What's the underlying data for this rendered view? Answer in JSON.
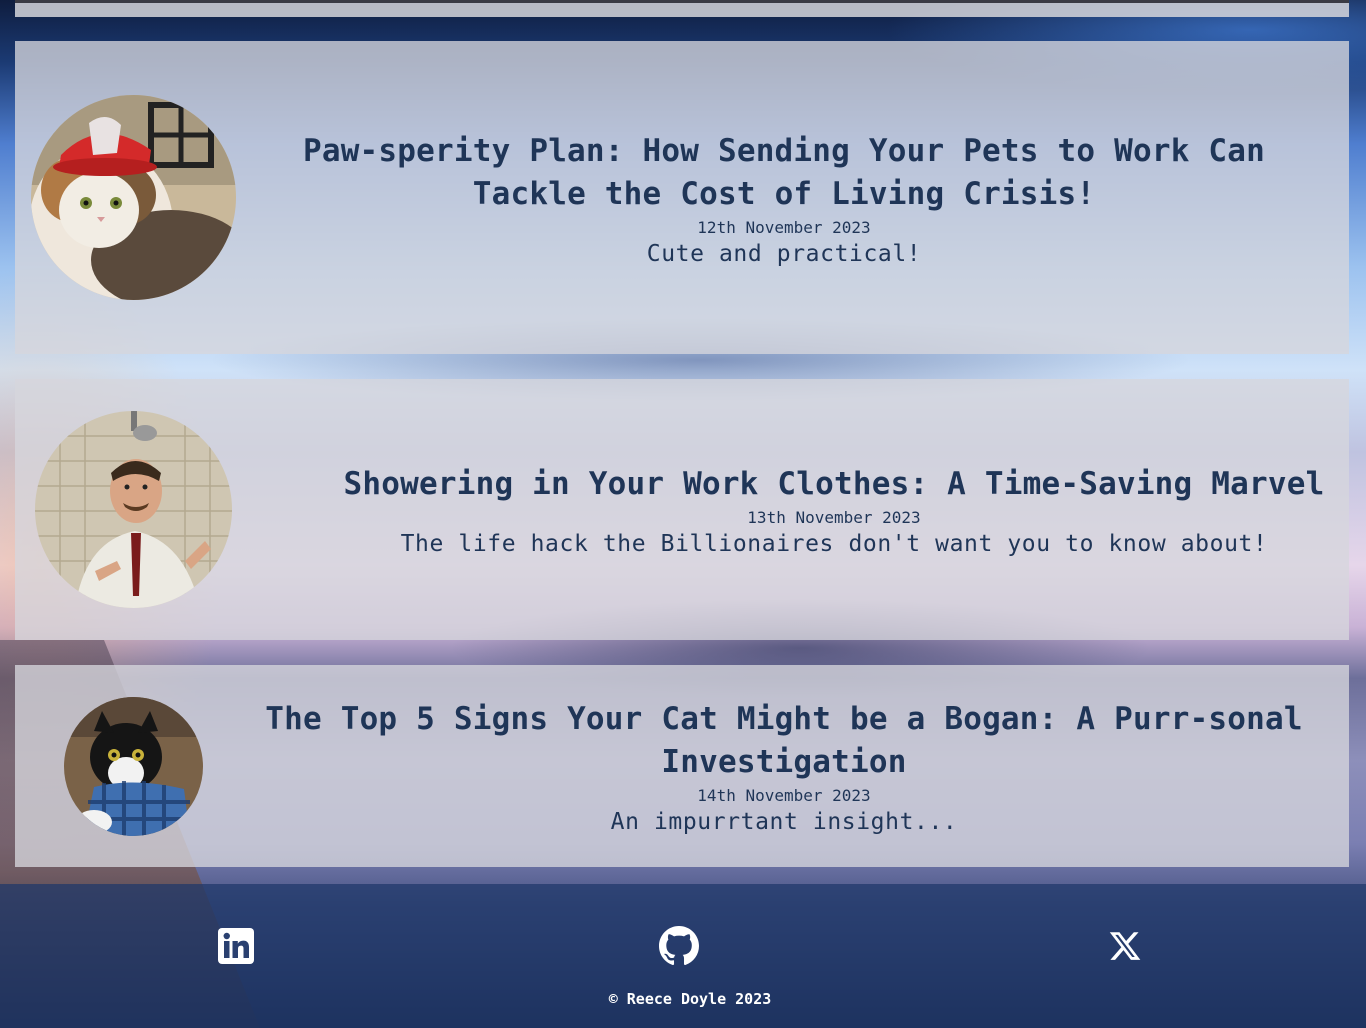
{
  "posts": [
    {
      "title": "Paw-sperity Plan: How Sending Your Pets to Work Can Tackle the Cost of Living Crisis!",
      "date": "12th November 2023",
      "description": "Cute and practical!",
      "image_subject": "cat wearing red firefighter helmet"
    },
    {
      "title": "Showering in Your Work Clothes: A Time-Saving Marvel",
      "date": "13th November 2023",
      "description": "The life hack the Billionaires don't want you to know about!",
      "image_subject": "man showering in shirt and tie"
    },
    {
      "title": "The Top 5 Signs Your Cat Might be a Bogan: A Purr-sonal Investigation",
      "date": "14th November 2023",
      "description": "An impurrtant insight...",
      "image_subject": "cat wearing blue flannel shirt"
    }
  ],
  "footer": {
    "social": [
      {
        "icon": "linkedin-icon"
      },
      {
        "icon": "github-icon"
      },
      {
        "icon": "x-icon"
      }
    ],
    "copyright": "© Reece Doyle 2023"
  },
  "colors": {
    "text": "#1f3557",
    "card_bg": "#d6d6dc",
    "footer_bg": "#1e3769"
  }
}
